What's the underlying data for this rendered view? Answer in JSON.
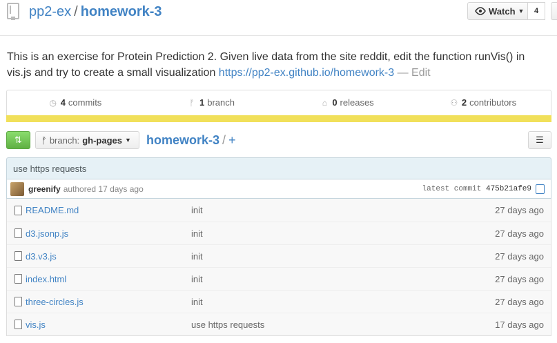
{
  "repo": {
    "owner": "pp2-ex",
    "separator": "/",
    "name": "homework-3"
  },
  "actions": {
    "watch_label": "Watch",
    "watch_count": "4"
  },
  "description": {
    "text": "This is an exercise for Protein Prediction 2. Given live data from the site reddit, edit the function runVis() in vis.js and try to create a small visualization",
    "link": "https://pp2-ex.github.io/homework-3",
    "sep": " — ",
    "edit": "Edit"
  },
  "numbers": {
    "commits_count": "4",
    "commits_label": "commits",
    "branch_count": "1",
    "branch_label": "branch",
    "releases_count": "0",
    "releases_label": "releases",
    "contributors_count": "2",
    "contributors_label": "contributors",
    "language_color": "#f1e05a"
  },
  "toolbar": {
    "branch_label": "branch:",
    "branch_name": "gh-pages",
    "path_root": "homework-3",
    "path_sep": "/",
    "path_add": "+"
  },
  "commit": {
    "message": "use https requests",
    "author": "greenify",
    "authored": "authored 17 days ago",
    "latest_label": "latest commit",
    "sha": "475b21afe9"
  },
  "files": [
    {
      "name": "README.md",
      "message": "init",
      "age": "27 days ago"
    },
    {
      "name": "d3.jsonp.js",
      "message": "init",
      "age": "27 days ago"
    },
    {
      "name": "d3.v3.js",
      "message": "init",
      "age": "27 days ago"
    },
    {
      "name": "index.html",
      "message": "init",
      "age": "27 days ago"
    },
    {
      "name": "three-circles.js",
      "message": "init",
      "age": "27 days ago"
    },
    {
      "name": "vis.js",
      "message": "use https requests",
      "age": "17 days ago"
    }
  ],
  "colors": {
    "link": "#4183c4",
    "compare_green": "#60b044"
  }
}
